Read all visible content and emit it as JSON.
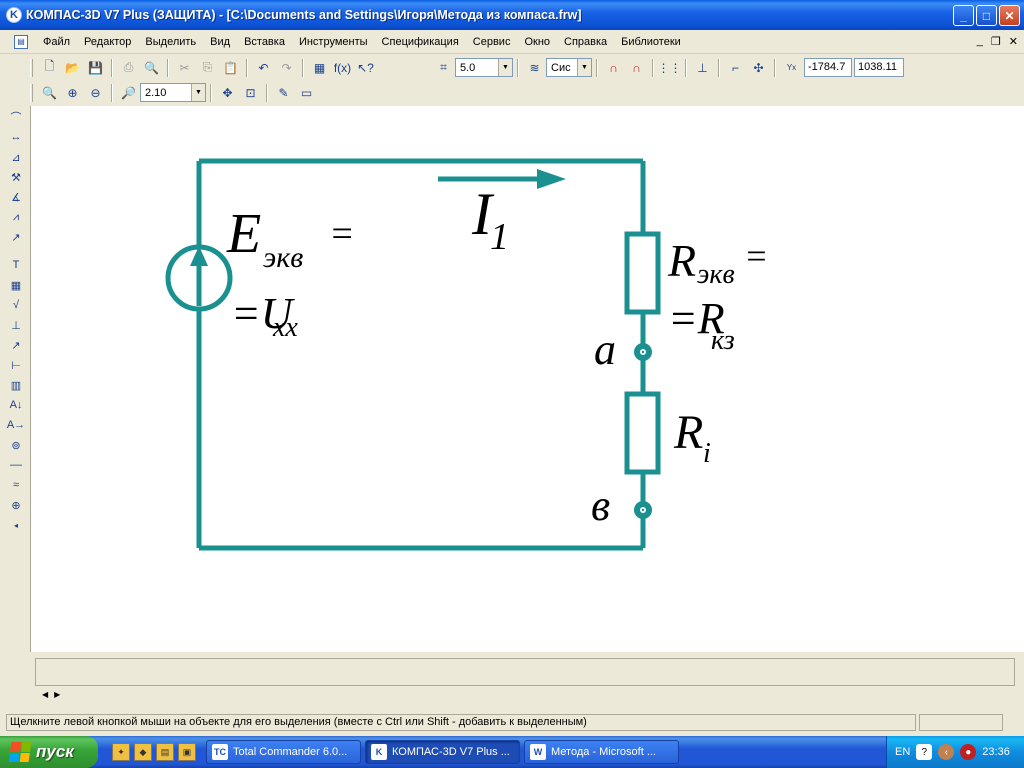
{
  "window": {
    "title": "КОМПАС-3D V7 Plus (ЗАЩИТА) - [C:\\Documents and Settings\\Игоря\\Метода из компаса.frw]",
    "app_icon": "K"
  },
  "menu": {
    "items": [
      "Файл",
      "Редактор",
      "Выделить",
      "Вид",
      "Вставка",
      "Инструменты",
      "Спецификация",
      "Сервис",
      "Окно",
      "Справка",
      "Библиотеки"
    ]
  },
  "toolbar": {
    "step_value": "5.0",
    "cs_value": "Сис",
    "coord_x": "-1784.7",
    "coord_y": "1038.11",
    "fx_label": "f(x)",
    "zoom_value": "2.10"
  },
  "diagram": {
    "E_main": "E",
    "E_sub": "экв",
    "equals": "=",
    "Uxx_prefix": "=U",
    "Uxx_sub": "хх",
    "I_main": "I",
    "I_sub": "1",
    "Req_main": "R",
    "Req_sub": "экв",
    "Req_eq": "=",
    "Rkz_prefix": "=R",
    "Rkz_sub": "кз",
    "Ri_main": "R",
    "Ri_sub": "i",
    "node_a": "a",
    "node_b": "в",
    "line_color": "#1a9090"
  },
  "status": {
    "message": "Щелкните левой кнопкой мыши на объекте для его выделения (вместе с Ctrl или Shift - добавить к выделенным)"
  },
  "taskbar": {
    "start_label": "пуск",
    "tasks": [
      {
        "label": "Total Commander 6.0...",
        "icon": "TC"
      },
      {
        "label": "КОМПАС-3D V7 Plus ...",
        "icon": "K"
      },
      {
        "label": "Метода - Microsoft ...",
        "icon": "W"
      }
    ],
    "lang": "EN",
    "clock": "23:36"
  }
}
